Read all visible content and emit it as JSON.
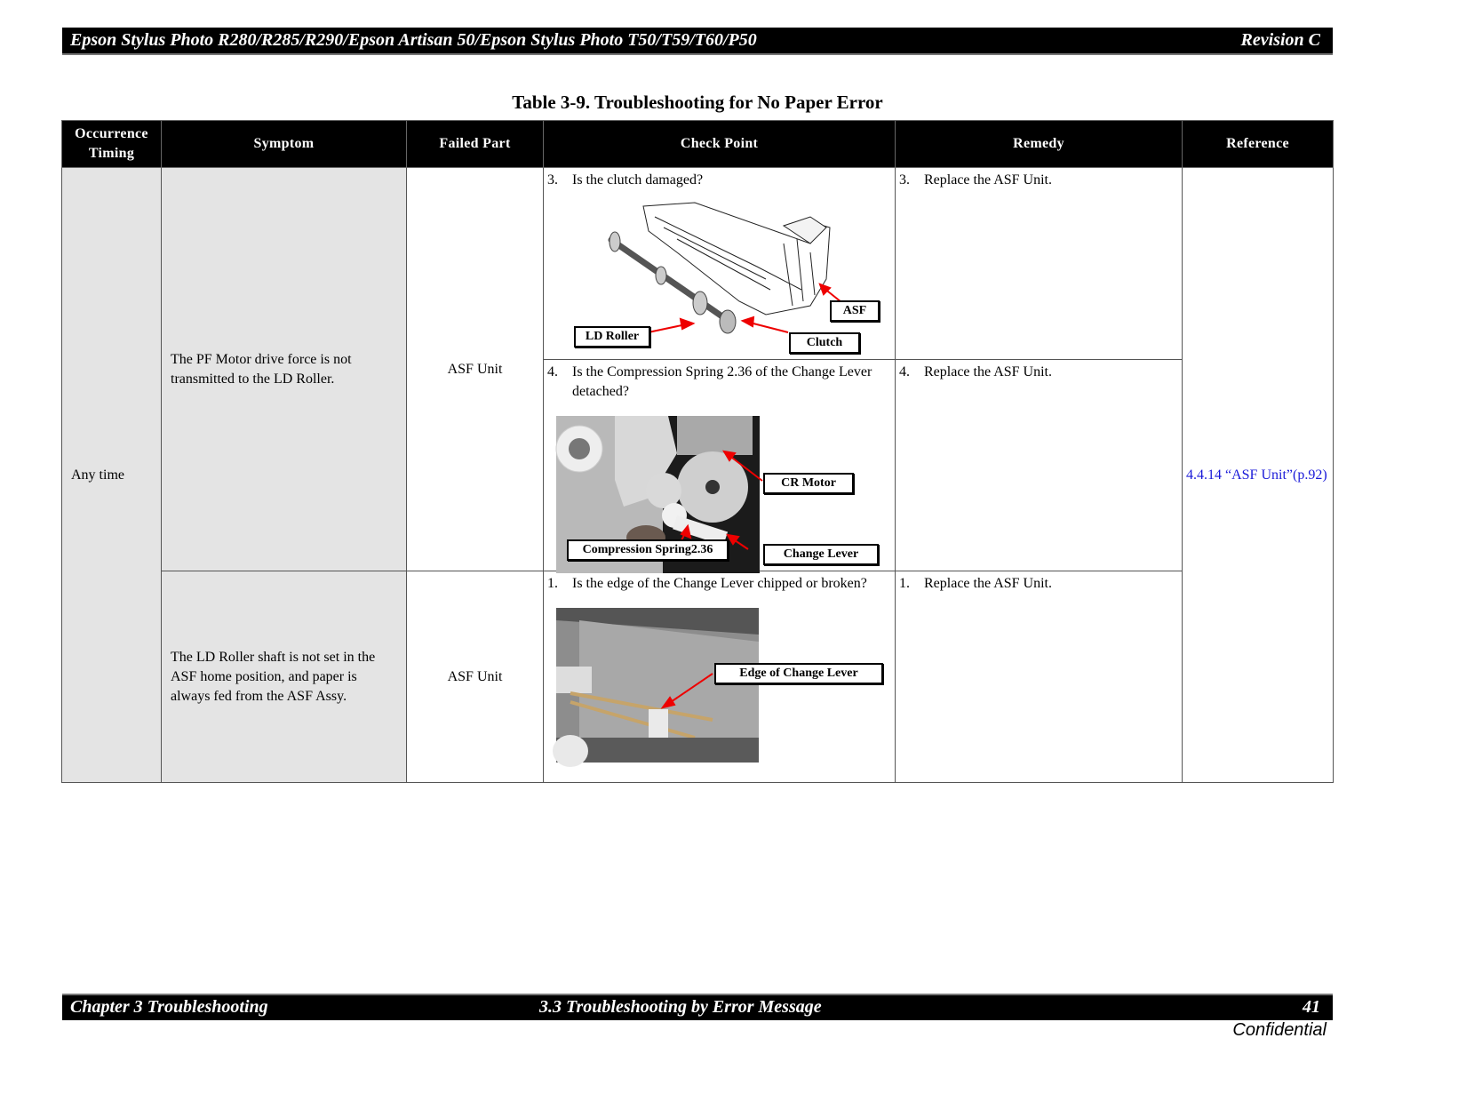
{
  "header": {
    "doc_title": "Epson Stylus Photo R280/R285/R290/Epson Artisan 50/Epson Stylus Photo T50/T59/T60/P50",
    "revision": "Revision C"
  },
  "table_title": "Table 3-9.  Troubleshooting for No Paper Error",
  "columns": [
    "Occurrence Timing",
    "Symptom",
    "Failed Part",
    "Check Point",
    "Remedy",
    "Reference"
  ],
  "occurrence_timing": "Any time",
  "reference_link": "4.4.14 “ASF Unit”(p.92)",
  "rows": [
    {
      "symptom": "The PF Motor drive force is not transmitted to the LD Roller.",
      "failed_part": "ASF Unit",
      "checks": [
        {
          "num": "3.",
          "check": "Is the clutch damaged?",
          "remedy_num": "3.",
          "remedy": "Replace the ASF Unit.",
          "figure": "asf-unit-drawing",
          "callouts": [
            "ASF",
            "LD Roller",
            "Clutch"
          ]
        },
        {
          "num": "4.",
          "check": "Is the Compression Spring 2.36 of the Change Lever detached?",
          "remedy_num": "4.",
          "remedy": "Replace the ASF Unit.",
          "figure": "change-lever-photo",
          "callouts": [
            "CR Motor",
            "Compression Spring2.36",
            "Change Lever"
          ]
        }
      ]
    },
    {
      "symptom": "The LD Roller shaft is not set in the ASF home position, and paper is always fed from the ASF Assy.",
      "failed_part": "ASF Unit",
      "checks": [
        {
          "num": "1.",
          "check": "Is the edge of the Change Lever chipped or broken?",
          "remedy_num": "1.",
          "remedy": "Replace the ASF Unit.",
          "figure": "change-lever-edge-photo",
          "callouts": [
            "Edge of Change Lever"
          ]
        }
      ]
    }
  ],
  "footer": {
    "chapter": "Chapter 3 Troubleshooting",
    "section": "3.3  Troubleshooting by Error Message",
    "page_number": "41",
    "confidential": "Confidential"
  }
}
